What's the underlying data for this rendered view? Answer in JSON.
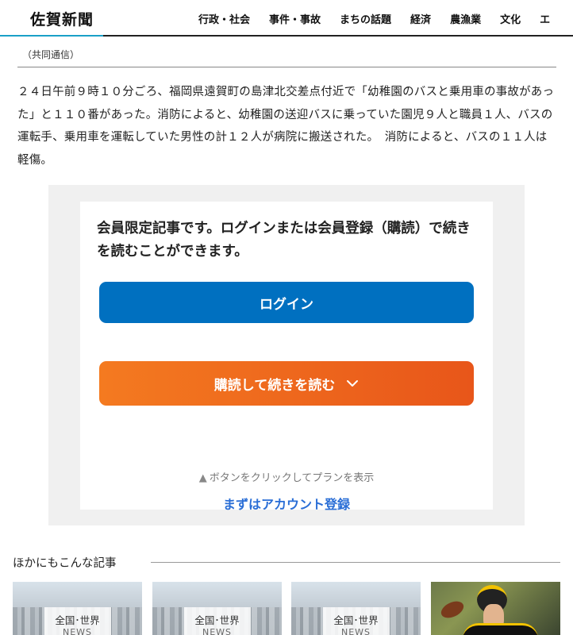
{
  "header": {
    "logo": "佐賀新聞",
    "nav": [
      "行政・社会",
      "事件・事故",
      "まちの話題",
      "経済",
      "農漁業",
      "文化",
      "エ"
    ]
  },
  "article": {
    "source": "（共同通信）",
    "body": "２４日午前９時１０分ごろ、福岡県遠賀町の島津北交差点付近で「幼稚園のバスと乗用車の事故があった」と１１０番があった。消防によると、幼稚園の送迎バスに乗っていた園児９人と職員１人、バスの運転手、乗用車を運転していた男性の計１２人が病院に搬送された。　消防によると、バスの１１人は軽傷。"
  },
  "paywall": {
    "message": "会員限定記事です。ログインまたは会員登録（購読）で続きを読むことができます。",
    "login_label": "ログイン",
    "subscribe_label": "購読して続きを読む",
    "hint": "ボタンをクリックしてプランを表示",
    "register_label": "まずはアカウント登録",
    "colors": {
      "login": "#0070c0",
      "subscribe": "#f47a20",
      "link": "#2a6ed6"
    }
  },
  "related": {
    "title": "ほかにもこんな記事",
    "items": [
      {
        "category": "全国･世界",
        "tag": "NEWS"
      },
      {
        "category": "全国･世界",
        "tag": "NEWS"
      },
      {
        "category": "全国･世界",
        "tag": "NEWS"
      },
      {
        "category": "",
        "tag": ""
      }
    ]
  }
}
